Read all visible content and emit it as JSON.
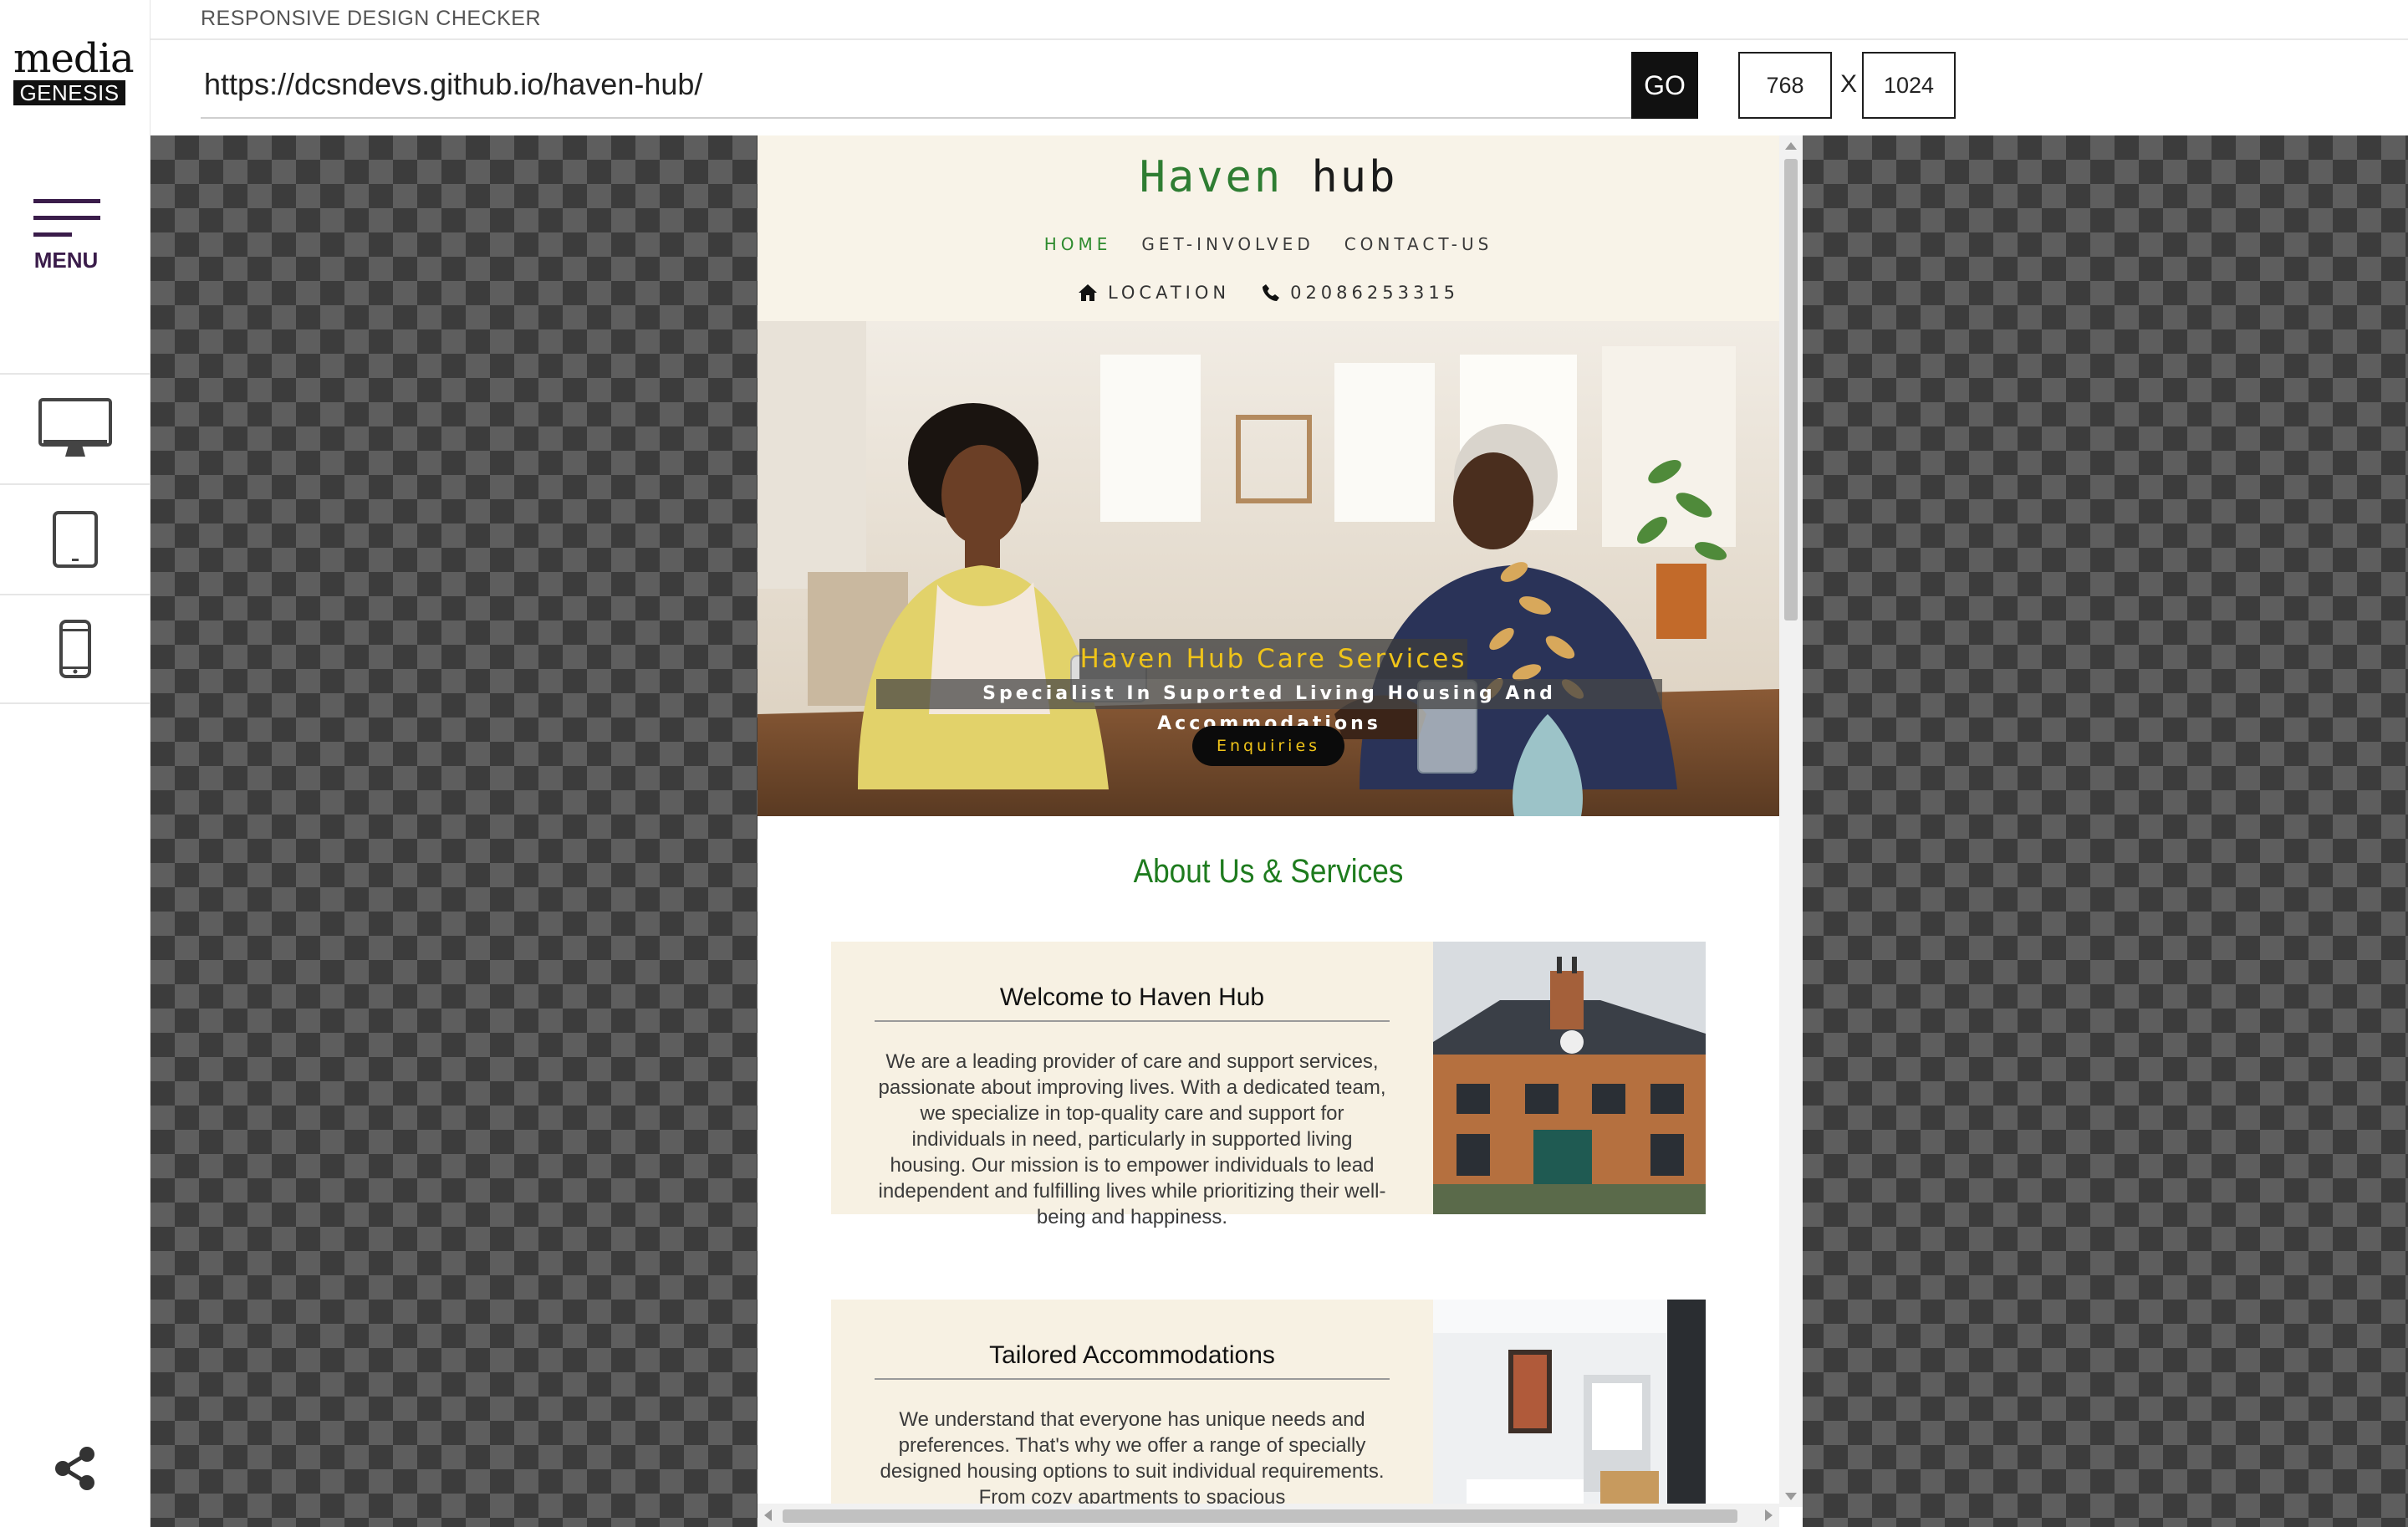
{
  "app": {
    "title": "RESPONSIVE DESIGN CHECKER",
    "logo_top": "media",
    "logo_bottom": "GENESIS",
    "menu_label": "MENU",
    "devices": [
      "desktop-icon",
      "tablet-icon",
      "mobile-icon"
    ],
    "share_icon": "share-icon",
    "accent_color": "#3a1c4a"
  },
  "toolbar": {
    "url": "https://dcsndevs.github.io/haven-hub/",
    "go_label": "GO",
    "width": "768",
    "separator": "X",
    "height": "1024"
  },
  "site": {
    "brand_first": "Haven",
    "brand_second": "hub",
    "nav": [
      "HOME",
      "GET-INVOLVED",
      "CONTACT-US"
    ],
    "contact": {
      "location": "LOCATION",
      "phone": "02086253315"
    },
    "hero": {
      "title": "Haven Hub Care Services",
      "subtitle": "Specialist In Suported Living Housing And Accommodations",
      "button": "Enquiries"
    },
    "about_heading": "About Us & Services",
    "cards": [
      {
        "title": "Welcome to Haven Hub",
        "text": "We are a leading provider of care and support services, passionate about improving lives. With a dedicated team, we specialize in top-quality care and support for individuals in need, particularly in supported living housing. Our mission is to empower individuals to lead independent and fulfilling lives while prioritizing their well-being and happiness."
      },
      {
        "title": "Tailored Accommodations",
        "text": "We understand that everyone has unique needs and preferences. That's why we offer a range of specially designed housing options to suit individual requirements. From cozy apartments to spacious"
      }
    ],
    "colors": {
      "brand_green": "#2e7d32",
      "header_bg": "#f8f3e8",
      "hero_gold": "#f0c419"
    }
  }
}
